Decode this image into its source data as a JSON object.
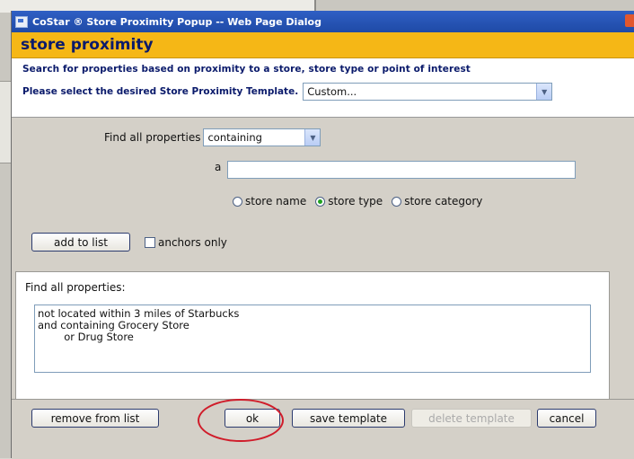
{
  "window": {
    "title": "CoStar ® Store Proximity Popup -- Web Page Dialog"
  },
  "header": {
    "title": "store proximity"
  },
  "intro": {
    "description": "Search for properties based on proximity to a store, store type or point of interest",
    "template_label": "Please select the desired Store Proximity Template.",
    "template_value": "Custom..."
  },
  "criteria": {
    "find_label": "Find all properties",
    "condition_value": "containing",
    "bullet": "a",
    "text_value": "",
    "radios": [
      {
        "label": "store name",
        "checked": false
      },
      {
        "label": "store type",
        "checked": true
      },
      {
        "label": "store category",
        "checked": false
      }
    ],
    "add_button": "add to list",
    "anchors_label": "anchors only",
    "anchors_checked": false
  },
  "properties": {
    "title": "Find all properties:",
    "lines": [
      "not located within 3 miles of Starbucks",
      "and containing Grocery Store",
      "        or Drug Store"
    ]
  },
  "buttons": {
    "remove": "remove from list",
    "ok": "ok",
    "save": "save template",
    "delete": "delete template",
    "cancel": "cancel"
  },
  "colors": {
    "header_bg": "#f5b716",
    "title_text": "#0a1a6b",
    "highlight_ellipse": "#d01c2a"
  }
}
